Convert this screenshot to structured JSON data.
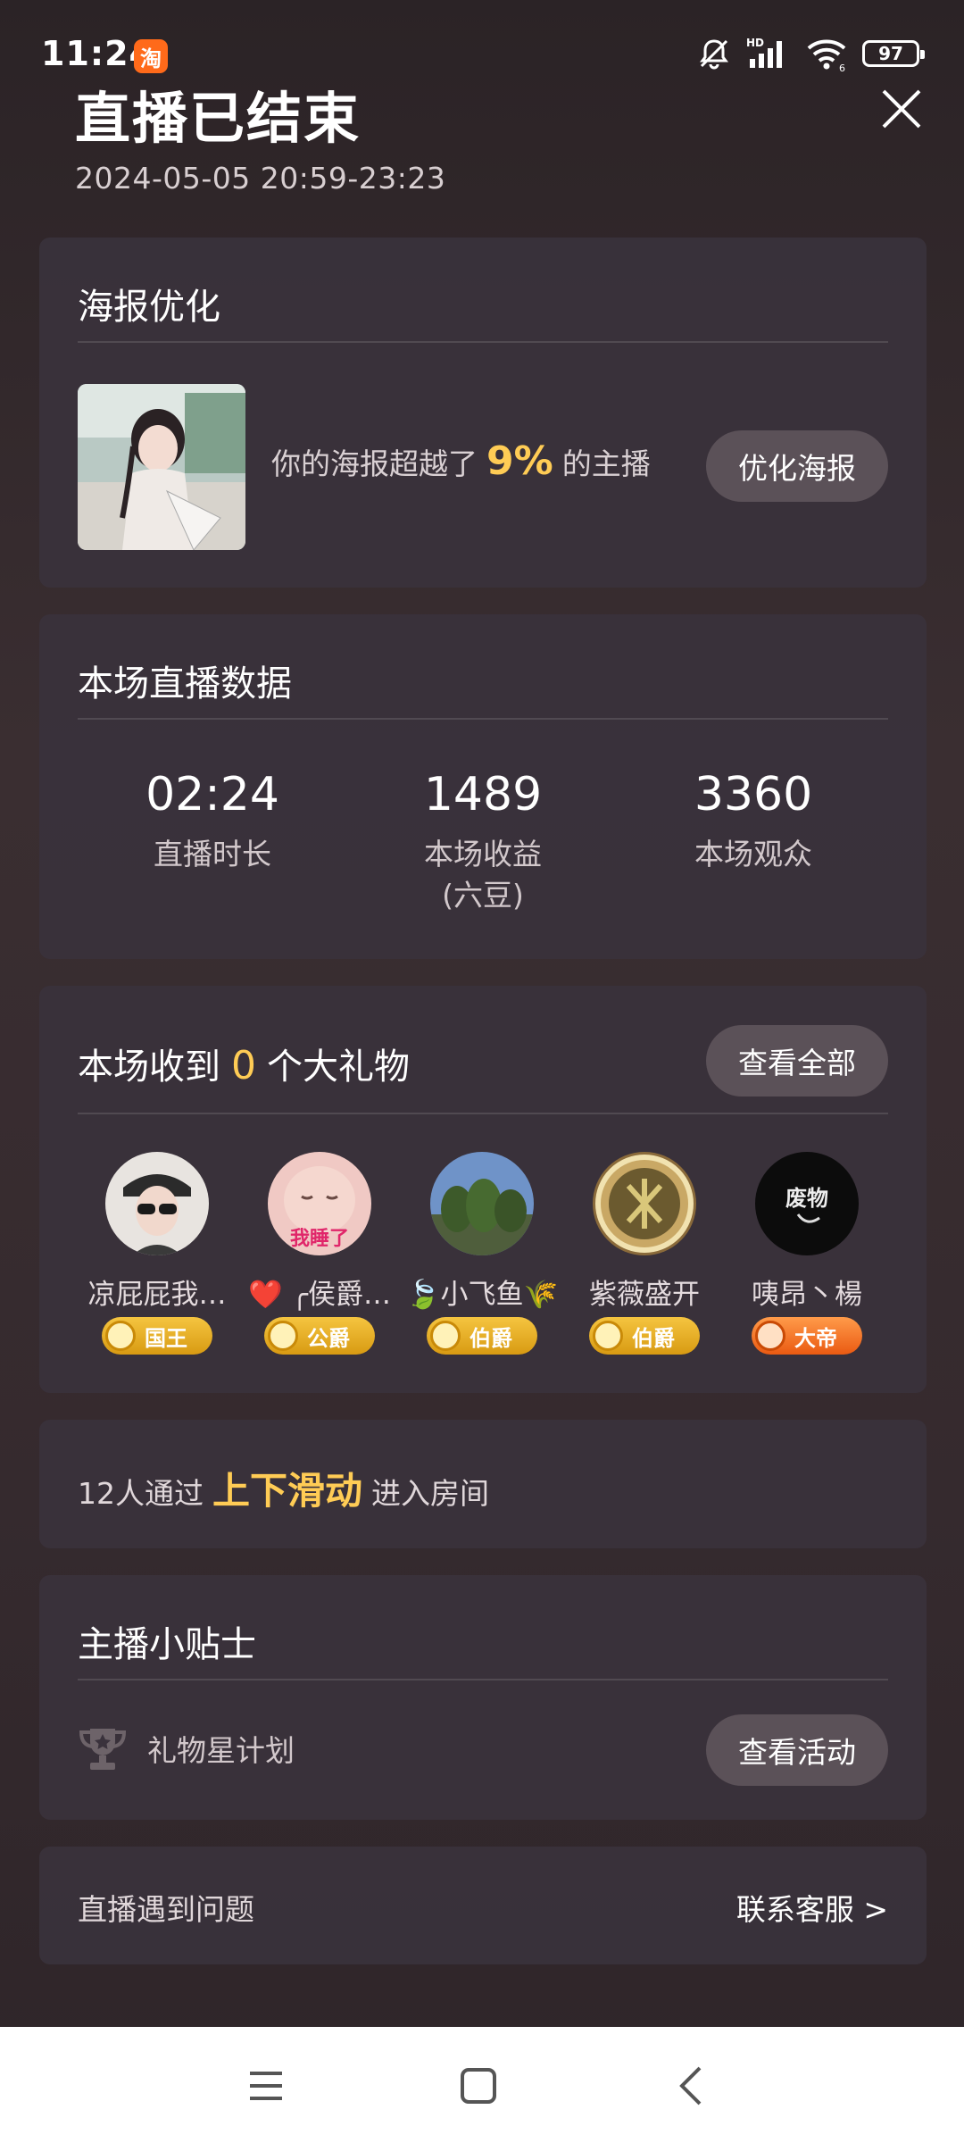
{
  "status_bar": {
    "time": "11:24",
    "app_badge": "淘",
    "hd": "HD",
    "wifi_sub": "6",
    "battery": "97"
  },
  "header": {
    "title": "直播已结束",
    "time_range": "2024-05-05 20:59-23:23"
  },
  "poster": {
    "title": "海报优化",
    "text_before": "你的海报超越了",
    "percent": "9%",
    "text_after": "的主播",
    "button": "优化海报"
  },
  "stats": {
    "title": "本场直播数据",
    "items": [
      {
        "value": "02:24",
        "label": "直播时长",
        "sub": ""
      },
      {
        "value": "1489",
        "label": "本场收益",
        "sub": "(六豆)"
      },
      {
        "value": "3360",
        "label": "本场观众",
        "sub": ""
      }
    ]
  },
  "gifts": {
    "title_before": "本场收到",
    "count": "0",
    "title_after": "个大礼物",
    "button": "查看全部",
    "users": [
      {
        "name": "凉屁屁我…",
        "rank": "国王",
        "rank_color": "gold"
      },
      {
        "name": "❤️ ╭侯爵…",
        "rank": "公爵",
        "rank_color": "gold"
      },
      {
        "name": "🍃小飞鱼🌾",
        "rank": "伯爵",
        "rank_color": "gold"
      },
      {
        "name": "紫薇盛开",
        "rank": "伯爵",
        "rank_color": "gold"
      },
      {
        "name": "咦昂丶楊",
        "rank": "大帝",
        "rank_color": "orange"
      }
    ],
    "avatar_texts": {
      "user2": "我睡了",
      "user5": "废物"
    }
  },
  "slide": {
    "prefix": "12人通过",
    "highlight": "上下滑动",
    "suffix": "进入房间"
  },
  "tips": {
    "title": "主播小贴士",
    "item_label": "礼物星计划",
    "button": "查看活动"
  },
  "problem": {
    "label": "直播遇到问题",
    "link": "联系客服 >"
  },
  "colors": {
    "accent": "#ffcc55",
    "card_bg": "#3a323c",
    "button_bg": "#5b5158"
  }
}
